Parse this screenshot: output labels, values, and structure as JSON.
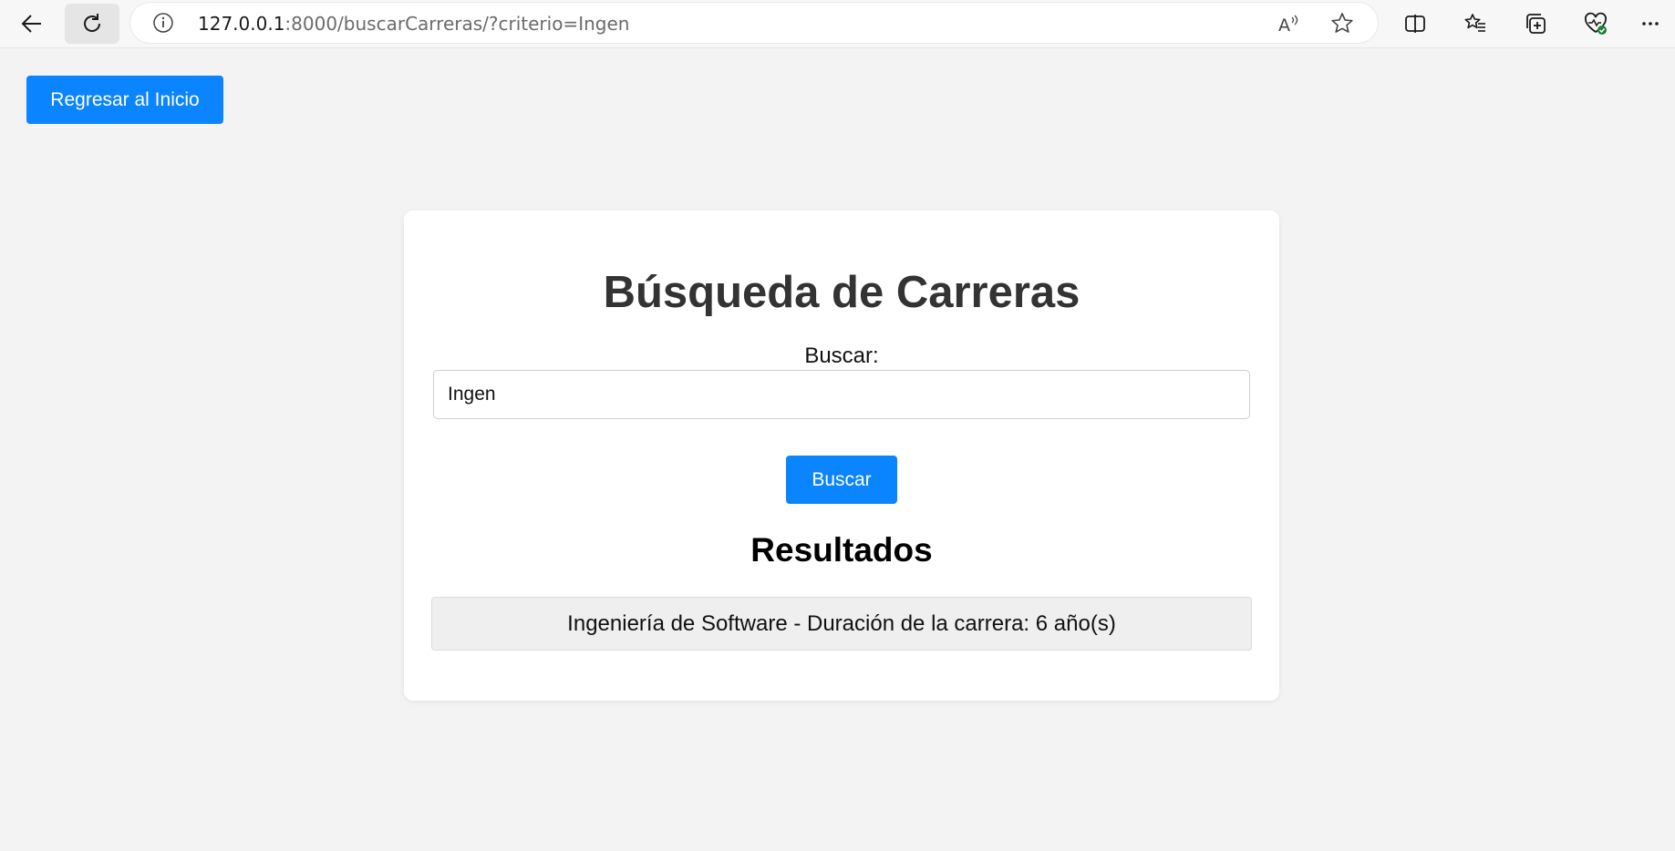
{
  "browser": {
    "url_host": "127.0.0.1",
    "url_rest": ":8000/buscarCarreras/?criterio=Ingen",
    "icons": {
      "back": "back-arrow-icon",
      "refresh": "refresh-icon",
      "info": "info-icon",
      "read_aloud": "read-aloud-icon",
      "favorite": "star-icon",
      "split": "split-screen-icon",
      "favorites": "favorites-icon",
      "collections": "collections-icon",
      "health": "browser-essentials-icon",
      "more": "more-icon"
    }
  },
  "page": {
    "home_button": "Regresar al Inicio",
    "title": "Búsqueda de Carreras",
    "search_label": "Buscar:",
    "search_value": "Ingen",
    "search_button": "Buscar",
    "results_title": "Resultados",
    "results": [
      "Ingeniería de Software - Duración de la carrera: 6 año(s)"
    ]
  },
  "colors": {
    "accent": "#0a84ff",
    "background": "#f3f3f3",
    "card": "#ffffff",
    "result_bg": "#efefef"
  }
}
